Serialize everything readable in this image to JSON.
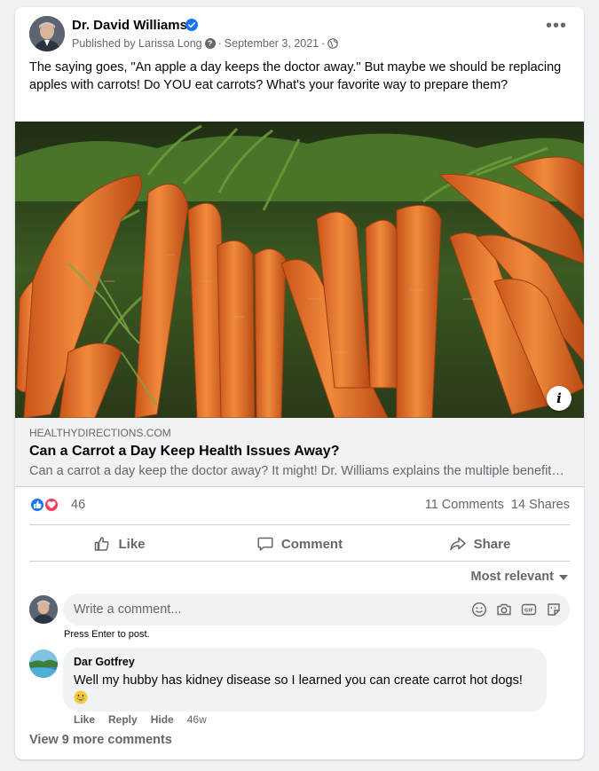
{
  "post": {
    "author": "Dr. David Williams",
    "published_by": "Published by Larissa Long",
    "separator": "·",
    "date": "September 3, 2021",
    "text": "The saying goes, \"An apple a day keeps the doctor away.\" But maybe we should be replacing apples with carrots! Do YOU eat carrots? What's your favorite way to prepare them?",
    "more_icon": "more-horizontal-icon"
  },
  "link_preview": {
    "domain": "HEALTHYDIRECTIONS.COM",
    "title": "Can a Carrot a Day Keep Health Issues Away?",
    "description": "Can a carrot a day keep the doctor away? It might! Dr. Williams explains the multiple benefits of carrots.",
    "info_label": "i"
  },
  "stats": {
    "reactions": "46",
    "comments": "11 Comments",
    "shares": "14 Shares"
  },
  "actions": {
    "like": "Like",
    "comment": "Comment",
    "share": "Share"
  },
  "comments": {
    "sort_label": "Most relevant",
    "placeholder": "Write a comment...",
    "hint": "Press Enter to post.",
    "items": [
      {
        "name": "Dar Gotfrey",
        "text": "Well my hubby has kidney disease so I learned you can create carrot hot dogs!",
        "like": "Like",
        "reply": "Reply",
        "hide": "Hide",
        "time": "46w"
      }
    ],
    "view_more": "View 9 more comments"
  },
  "colors": {
    "brand_blue": "#1877f2",
    "love_red": "#f33e58",
    "secondary_text": "#65676b",
    "carrot_orange": "#e8712a"
  }
}
